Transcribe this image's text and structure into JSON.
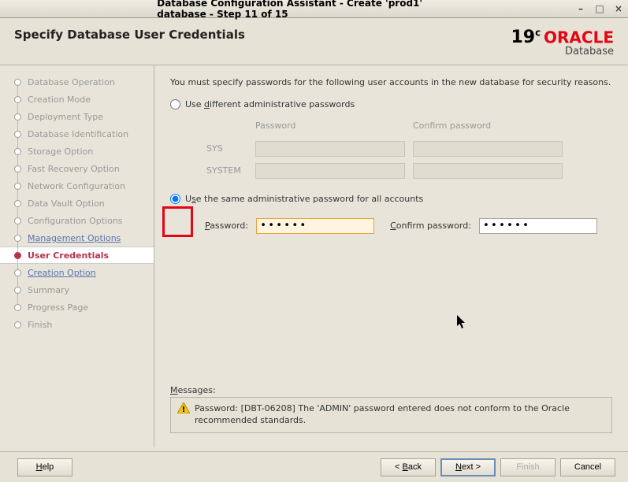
{
  "titlebar": {
    "title": "Database Configuration Assistant - Create 'prod1' database - Step 11 of 15"
  },
  "header": {
    "page_title": "Specify Database User Credentials",
    "logo_version": "19",
    "logo_sup": "c",
    "logo_brand": "ORACLE",
    "logo_product": "Database"
  },
  "sidebar": {
    "items": [
      {
        "label": "Database Operation",
        "state": "disabled"
      },
      {
        "label": "Creation Mode",
        "state": "disabled"
      },
      {
        "label": "Deployment Type",
        "state": "disabled"
      },
      {
        "label": "Database Identification",
        "state": "disabled"
      },
      {
        "label": "Storage Option",
        "state": "disabled"
      },
      {
        "label": "Fast Recovery Option",
        "state": "disabled"
      },
      {
        "label": "Network Configuration",
        "state": "disabled"
      },
      {
        "label": "Data Vault Option",
        "state": "disabled"
      },
      {
        "label": "Configuration Options",
        "state": "disabled"
      },
      {
        "label": "Management Options",
        "state": "completed"
      },
      {
        "label": "User Credentials",
        "state": "current"
      },
      {
        "label": "Creation Option",
        "state": "upcoming"
      },
      {
        "label": "Summary",
        "state": "disabled"
      },
      {
        "label": "Progress Page",
        "state": "disabled"
      },
      {
        "label": "Finish",
        "state": "disabled"
      }
    ]
  },
  "main": {
    "intro": "You must specify passwords for the following user accounts in the new database for security reasons.",
    "opt_diff": "Use different administrative passwords",
    "col_password": "Password",
    "col_confirm": "Confirm password",
    "row_sys": "SYS",
    "row_system": "SYSTEM",
    "opt_same": "Use the same administrative password for all accounts",
    "lbl_password": "Password:",
    "lbl_confirm": "Confirm password:",
    "val_password": "••••••",
    "val_confirm": "••••••",
    "messages_label": "Messages:",
    "message_text": "Password: [DBT-06208] The 'ADMIN' password entered does not conform to the Oracle recommended standards."
  },
  "footer": {
    "help": "Help",
    "back": "< Back",
    "next": "Next >",
    "finish": "Finish",
    "cancel": "Cancel"
  }
}
